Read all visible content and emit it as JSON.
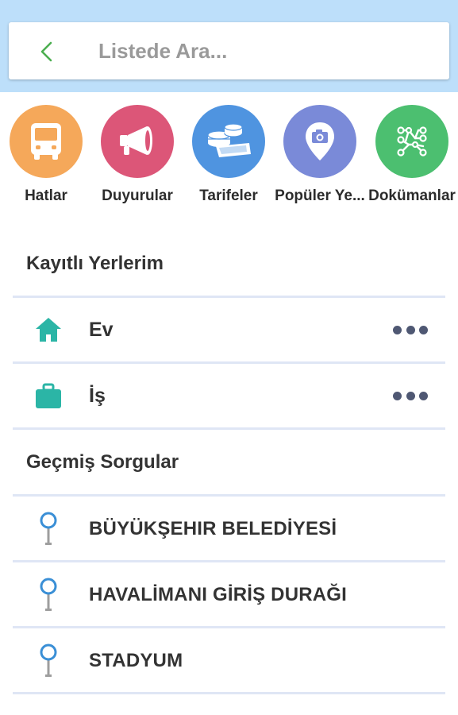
{
  "search": {
    "placeholder": "Listede Ara..."
  },
  "categories": [
    {
      "label": "Hatlar",
      "color": "#f5a85a",
      "icon": "bus-icon"
    },
    {
      "label": "Duyurular",
      "color": "#dc5678",
      "icon": "megaphone-icon"
    },
    {
      "label": "Tarifeler",
      "color": "#4f94e0",
      "icon": "money-icon"
    },
    {
      "label": "Popüler Ye...",
      "color": "#7a8ad8",
      "icon": "camera-pin-icon"
    },
    {
      "label": "Dokümanlar",
      "color": "#4cbf70",
      "icon": "route-map-icon"
    }
  ],
  "saved": {
    "title": "Kayıtlı Yerlerim",
    "items": [
      {
        "label": "Ev",
        "icon": "home-icon"
      },
      {
        "label": "İş",
        "icon": "briefcase-icon"
      }
    ]
  },
  "history": {
    "title": "Geçmiş Sorgular",
    "items": [
      {
        "label": "BÜYÜKŞEHIR BELEDİYESİ"
      },
      {
        "label": "HAVALİMANI GİRİŞ DURAĞI"
      },
      {
        "label": "STADYUM"
      }
    ]
  },
  "colors": {
    "topbar": "#bddffa",
    "accent_green": "#4caf50",
    "teal_icon": "#2bb5a6",
    "pin_blue": "#3a8fd6",
    "divider": "#dfe6f5"
  }
}
